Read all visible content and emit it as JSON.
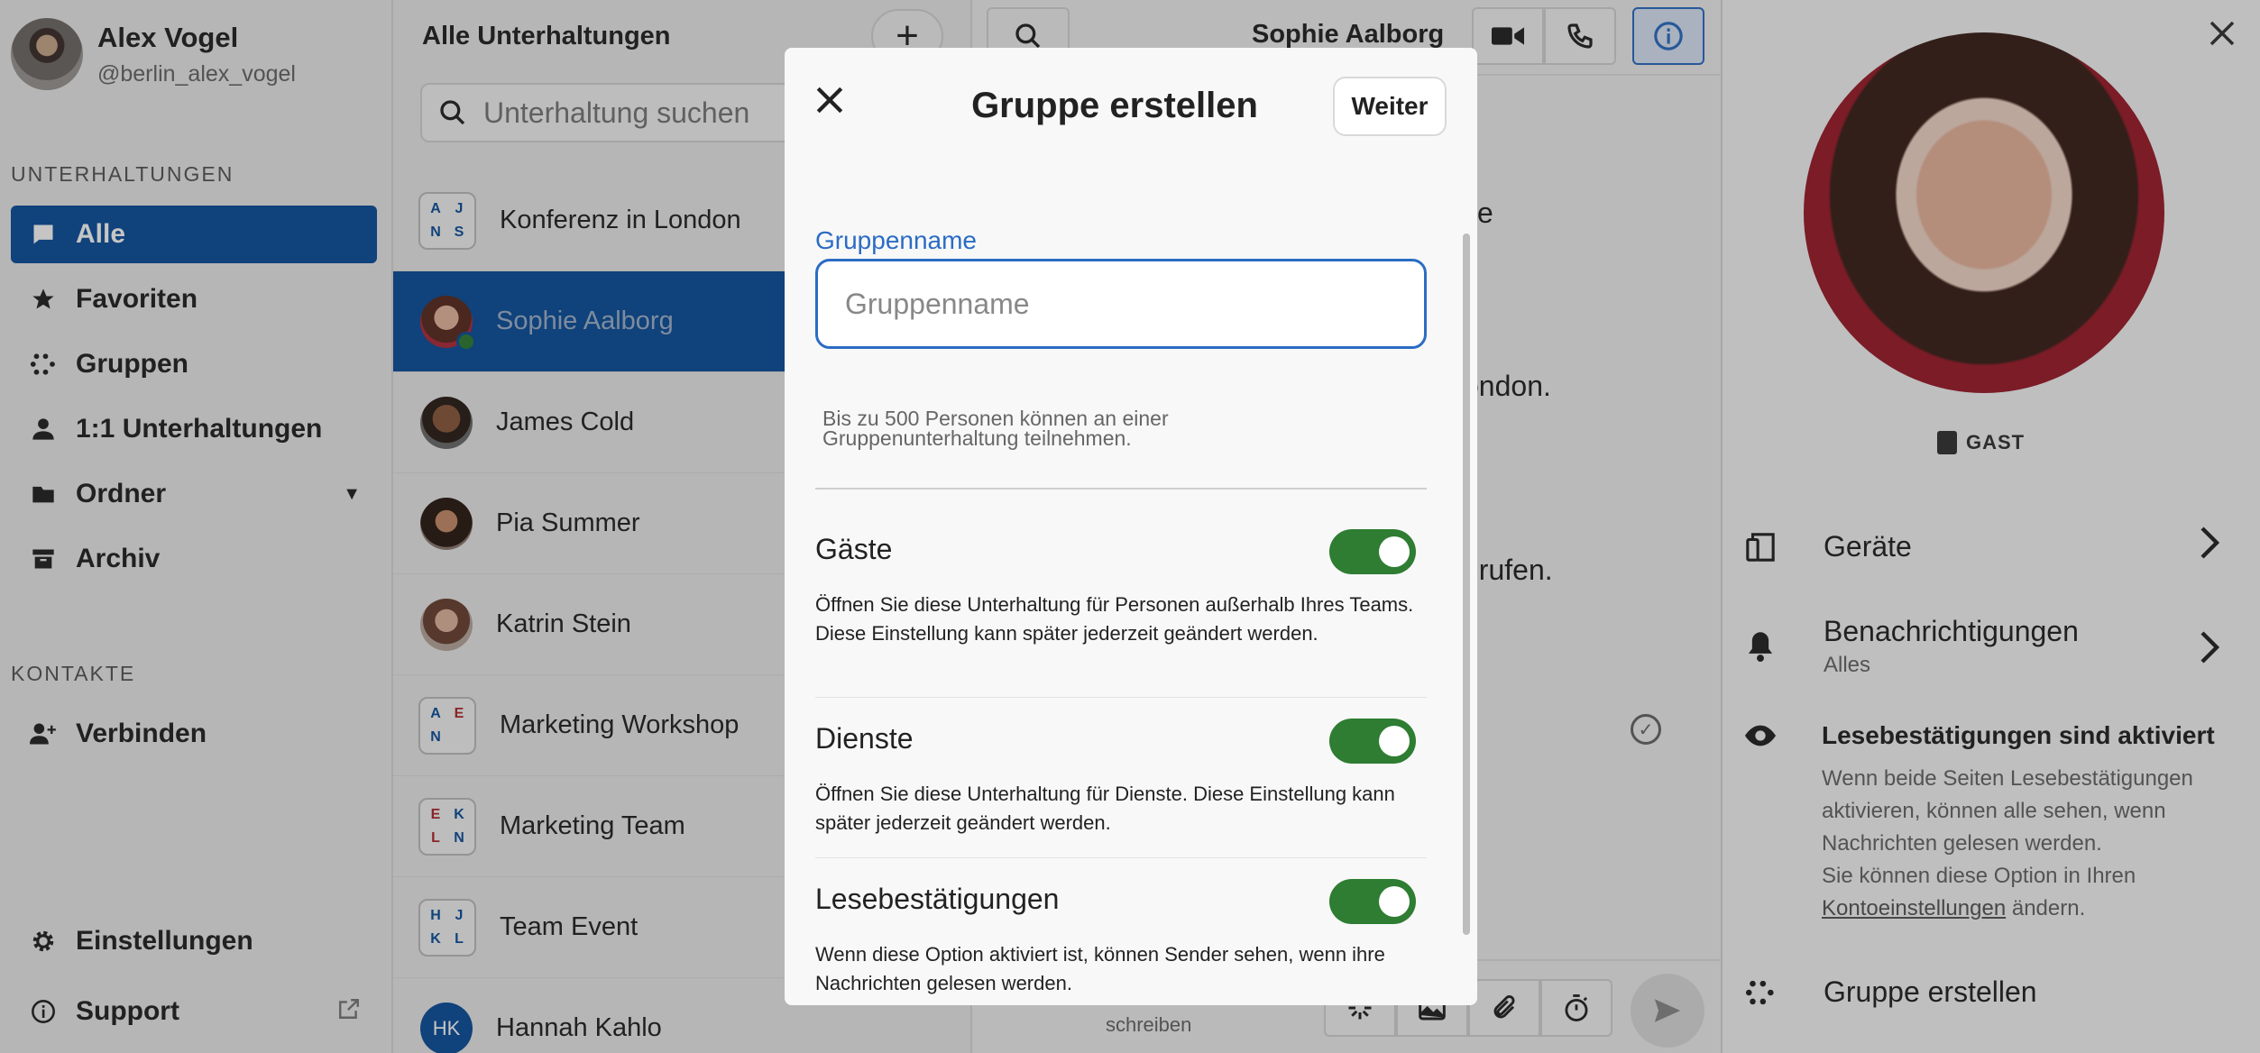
{
  "user": {
    "name": "Alex Vogel",
    "handle": "@berlin_alex_vogel"
  },
  "sidebar": {
    "conversations_label": "UNTERHALTUNGEN",
    "items": [
      {
        "label": "Alle",
        "icon": "chat-bubble-icon",
        "active": true
      },
      {
        "label": "Favoriten",
        "icon": "star-icon"
      },
      {
        "label": "Gruppen",
        "icon": "group-dots-icon"
      },
      {
        "label": "1:1 Unterhaltungen",
        "icon": "person-icon"
      },
      {
        "label": "Ordner",
        "icon": "folder-icon",
        "expandable": true
      },
      {
        "label": "Archiv",
        "icon": "archive-icon"
      }
    ],
    "contacts_label": "KONTAKTE",
    "connect_label": "Verbinden",
    "settings_label": "Einstellungen",
    "support_label": "Support"
  },
  "conversation_list": {
    "title": "Alle Unterhaltungen",
    "search_placeholder": "Unterhaltung suchen",
    "rows": [
      {
        "name": "Konferenz in London",
        "initials": [
          "A",
          "J",
          "N",
          "S"
        ]
      },
      {
        "name": "Sophie Aalborg",
        "active": true,
        "online": true
      },
      {
        "name": "James Cold"
      },
      {
        "name": "Pia Summer"
      },
      {
        "name": "Katrin Stein"
      },
      {
        "name": "Marketing Workshop",
        "initials": [
          "A",
          "E",
          "N",
          ""
        ]
      },
      {
        "name": "Marketing Team",
        "initials": [
          "E",
          "K",
          "L",
          "N"
        ]
      },
      {
        "name": "Team Event",
        "initials": [
          "H",
          "J",
          "K",
          "L"
        ]
      },
      {
        "name": "Hannah Kahlo",
        "initials_avatar": "HK"
      }
    ]
  },
  "chat": {
    "title": "Sophie Aalborg",
    "fragments": [
      "e",
      "ondon.",
      "nrufen."
    ],
    "input_hint": "schreiben"
  },
  "details": {
    "badge": "GAST",
    "devices_label": "Geräte",
    "notifications_label": "Benachrichtigungen",
    "notifications_value": "Alles",
    "receipts_title": "Lesebestätigungen sind aktiviert",
    "receipts_desc_1": "Wenn beide Seiten Lesebestätigungen aktivieren, können alle sehen, wenn Nachrichten gelesen werden.",
    "receipts_desc_2": "Sie können diese Option in Ihren",
    "receipts_link": "Kontoeinstellungen",
    "receipts_desc_3": "ändern.",
    "create_group_label": "Gruppe erstellen"
  },
  "modal": {
    "title": "Gruppe erstellen",
    "next_label": "Weiter",
    "group_name_label": "Gruppenname",
    "group_name_placeholder": "Gruppenname",
    "group_name_value": "",
    "limit_hint": "Bis zu 500 Personen können an einer Gruppenunterhaltung teilnehmen.",
    "options": [
      {
        "title": "Gäste",
        "enabled": true,
        "description": "Öffnen Sie diese Unterhaltung für Personen außerhalb Ihres Teams. Diese Einstellung kann später jederzeit geändert werden."
      },
      {
        "title": "Dienste",
        "enabled": true,
        "description": "Öffnen Sie diese Unterhaltung für Dienste. Diese Einstellung kann später jederzeit geändert werden."
      },
      {
        "title": "Lesebestätigungen",
        "enabled": true,
        "description": "Wenn diese Option aktiviert ist, können Sender sehen, wenn ihre Nachrichten gelesen werden."
      }
    ]
  },
  "colors": {
    "accent": "#0b4f9c",
    "focus": "#2b6cc4",
    "toggle_on": "#2e7d32"
  }
}
